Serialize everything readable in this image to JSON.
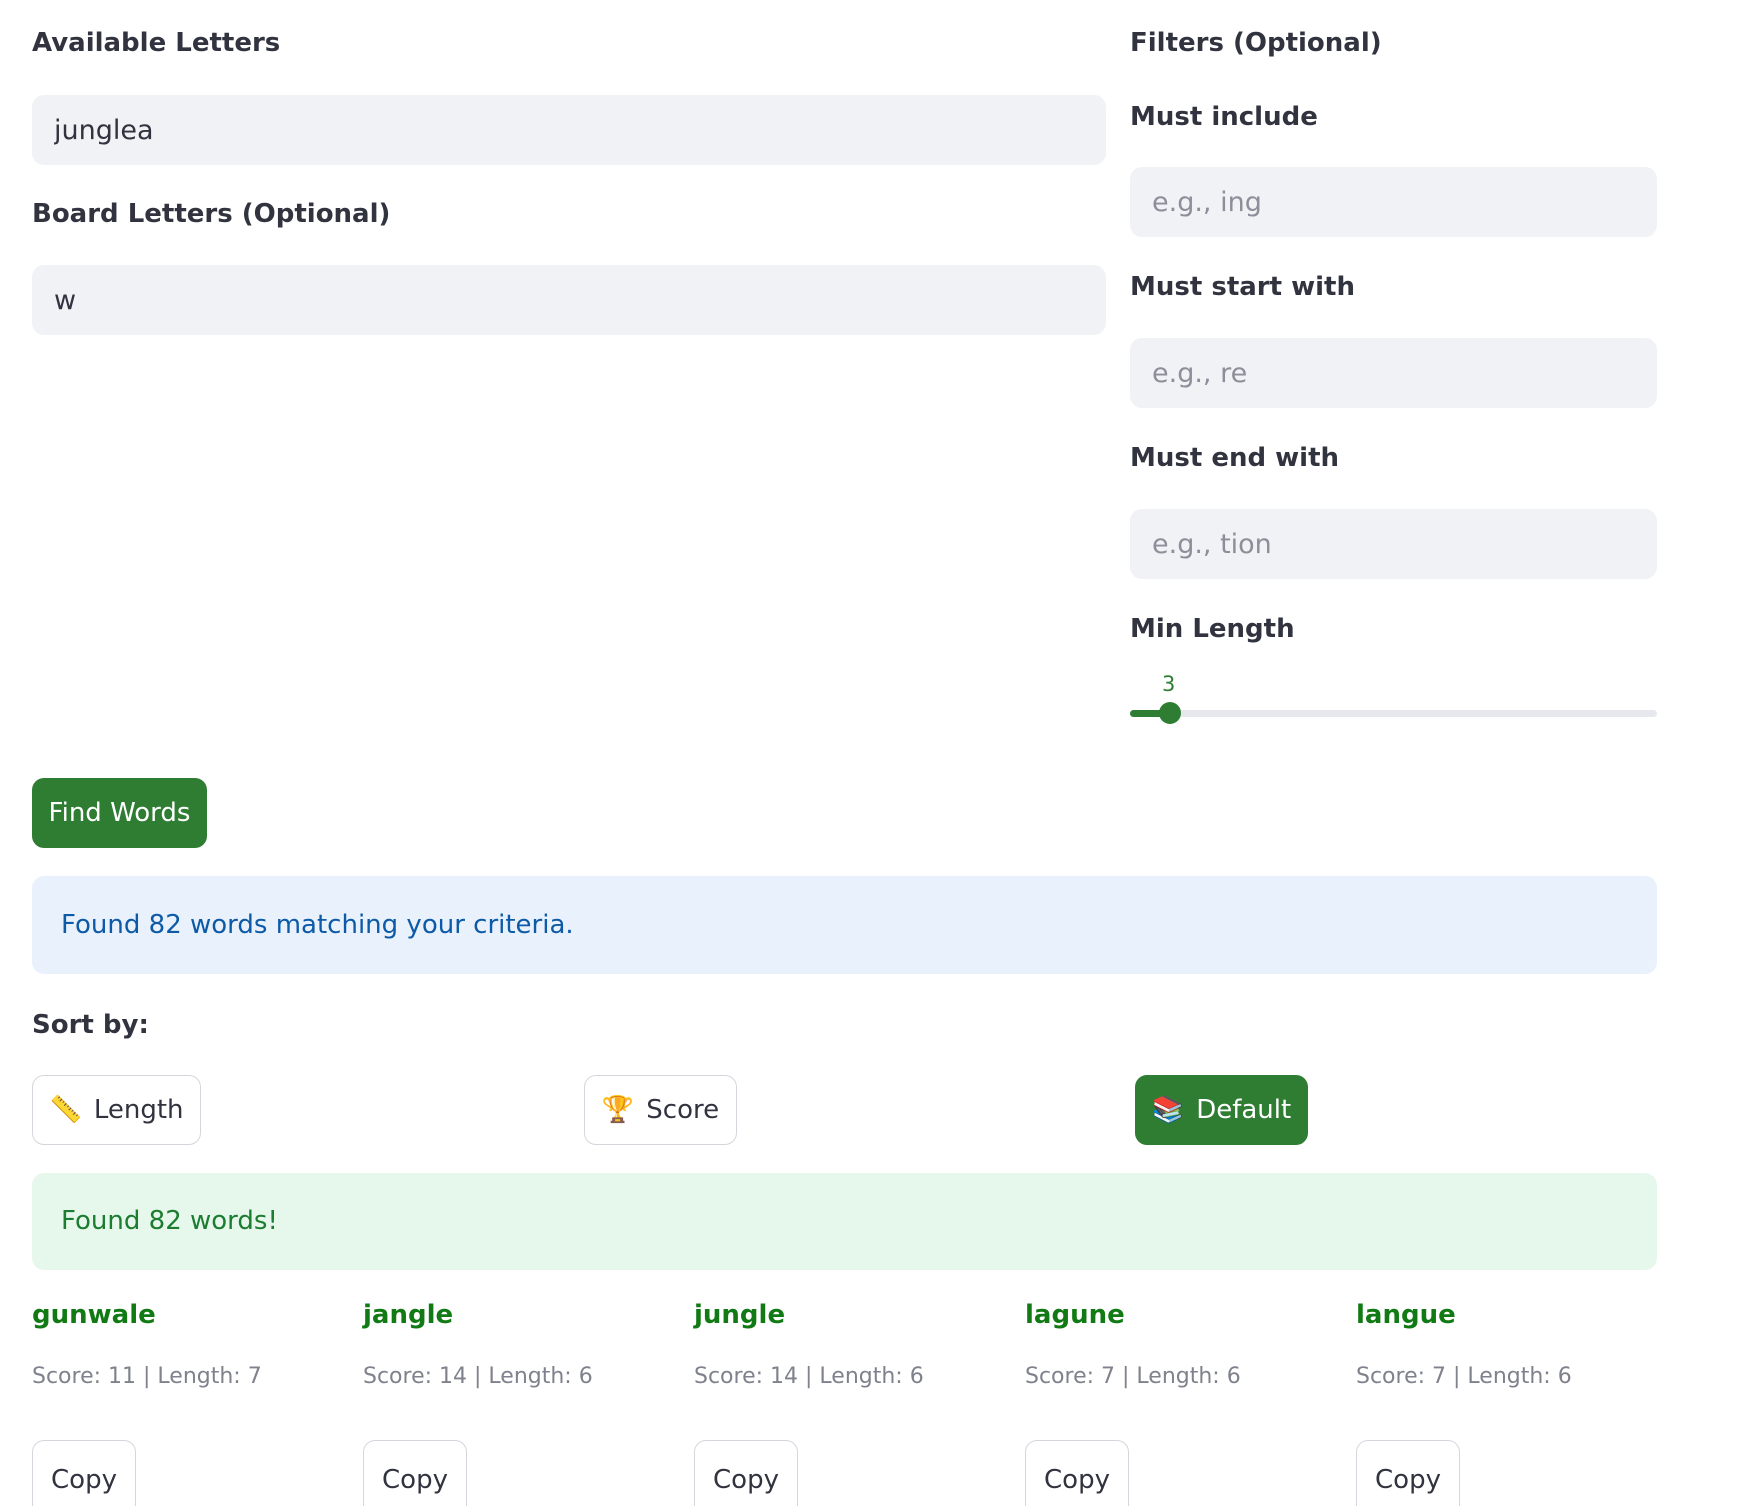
{
  "available_letters": {
    "label": "Available Letters",
    "value": "junglea"
  },
  "board_letters": {
    "label": "Board Letters (Optional)",
    "value": "w"
  },
  "filters": {
    "title": "Filters (Optional)",
    "must_include": {
      "label": "Must include",
      "placeholder": "e.g., ing",
      "value": ""
    },
    "must_start": {
      "label": "Must start with",
      "placeholder": "e.g., re",
      "value": ""
    },
    "must_end": {
      "label": "Must end with",
      "placeholder": "e.g., tion",
      "value": ""
    },
    "min_length": {
      "label": "Min Length",
      "value": "3",
      "fraction": 0.076
    }
  },
  "find_button": "Find Words",
  "info_message": "Found 82 words matching your criteria.",
  "sort": {
    "label": "Sort by:",
    "length": {
      "label": "Length",
      "icon": "ruler-icon",
      "glyph": "📏"
    },
    "score": {
      "label": "Score",
      "icon": "trophy-icon",
      "glyph": "🏆"
    },
    "default": {
      "label": "Default",
      "icon": "books-icon",
      "glyph": "📚"
    },
    "active": "default"
  },
  "success_message": "Found 82 words!",
  "results": [
    {
      "word": "gunwale",
      "meta": "Score: 11 | Length: 7",
      "copy": "Copy"
    },
    {
      "word": "jangle",
      "meta": "Score: 14 | Length: 6",
      "copy": "Copy"
    },
    {
      "word": "jungle",
      "meta": "Score: 14 | Length: 6",
      "copy": "Copy"
    },
    {
      "word": "lagune",
      "meta": "Score: 7 | Length: 6",
      "copy": "Copy"
    },
    {
      "word": "langue",
      "meta": "Score: 7 | Length: 6",
      "copy": "Copy"
    }
  ],
  "colors": {
    "primary": "#2e7d32",
    "input_bg": "#f0f2f6",
    "info_bg": "#e8f1fc",
    "info_text": "#0d5aa7",
    "success_bg": "#e6f7ec",
    "success_text": "#1c7c30",
    "word_text": "#117a14"
  }
}
